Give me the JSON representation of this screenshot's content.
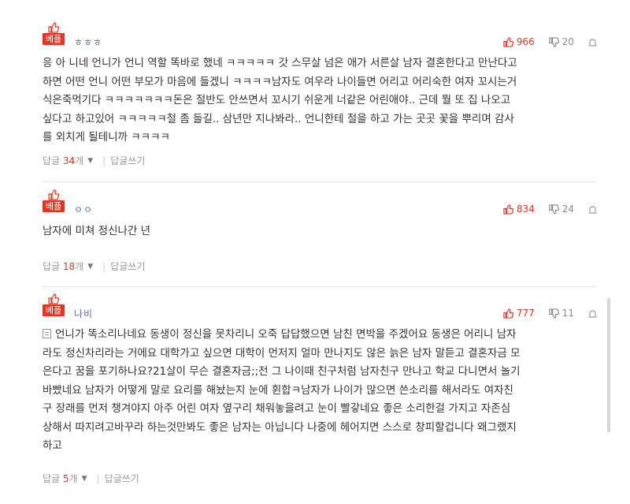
{
  "comments": [
    {
      "badge": "베플",
      "author": "ㅎㅎㅎ",
      "upvotes": "966",
      "downvotes": "20",
      "lines": [
        "응 아 니네 언니가 언니 역할 똑바로 했네 ㅋㅋㅋㅋㅋ 갓 스무살 넘은 애가 서른살 남자 결혼한다고 만난다고",
        "하면 어떤 언니 어떤 부모가 마음에 들겠니 ㅋㅋㅋㅋ남자도 여우라 나이들면 어리고 어리숙한 여자 꼬시는거",
        "식은죽먹기다 ㅋㅋㅋㅋㅋㅋㅋ돈은 절반도 안쓰면서 꼬시기 쉬운게 너같은 어린애야.. 근데 뭘 또 집 나오고",
        "싶다고 하고있어 ㅋㅋㅋㅋㅋ철 좀 들길.. 삼년만 지나봐라.. 언니한테 절을 하고 가는 곳곳 꽃을 뿌리며 감사",
        "를 외치게 될테니까 ㅋㅋㅋㅋ"
      ],
      "reply_label": "답글",
      "reply_count": "34",
      "reply_unit": "개",
      "write_label": "답글쓰기"
    },
    {
      "badge": "베플",
      "author": "ㅇㅇ",
      "upvotes": "834",
      "downvotes": "24",
      "lines": [
        "남자에 미쳐 정신나간 년"
      ],
      "reply_label": "답글",
      "reply_count": "18",
      "reply_unit": "개",
      "write_label": "답글쓰기"
    },
    {
      "badge": "베플",
      "author": "나비",
      "upvotes": "777",
      "downvotes": "11",
      "lines": [
        "언니가 똑소리나네요 동생이 정신을 못차리니 오죽 답답했으면 남친 면박을 주겠어요 동생은 어리니 남자",
        "라도 정신차리라는 거에요 대학가고 싶으면 대학이 먼저지 얼마 만나지도 않은 늙은 남자 말듣고 결혼자금 모",
        "은다고 꿈을 포기하나요?21살이 무슨 결혼자금;;전 그 나이때 친구처럼 남자친구 만나고 학교 다니면서 놀기",
        "바빴네요 남자가 어떻게 말로 요리를 해놨는지 눈에 휜합ㅋ남자가 나이가 많으면 쓴소리를 해서라도 여자친",
        "구 장래를 먼저 챙겨야지 아주 어린 여자 옆구리 채워놓을려고 눈이 빨갛네요 좋은 소리한걸 가지고 자존심",
        "상해서 따지려고바꾸라 하는것만봐도 좋은 남자는 아닙니다 나중에 헤어지면 스스로 창피할겁니다 왜그랬지",
        "하고"
      ],
      "reply_label": "답글",
      "reply_count": "5",
      "reply_unit": "개",
      "write_label": "답글쓰기"
    }
  ],
  "icons": {
    "best": "thumbs-up-icon",
    "up": "thumbs-up-icon",
    "down": "thumbs-down-icon",
    "report": "siren-icon",
    "memo": "memo-icon"
  },
  "colors": {
    "accent": "#e8331f",
    "author": "#5a6eb5",
    "muted": "#999999"
  }
}
